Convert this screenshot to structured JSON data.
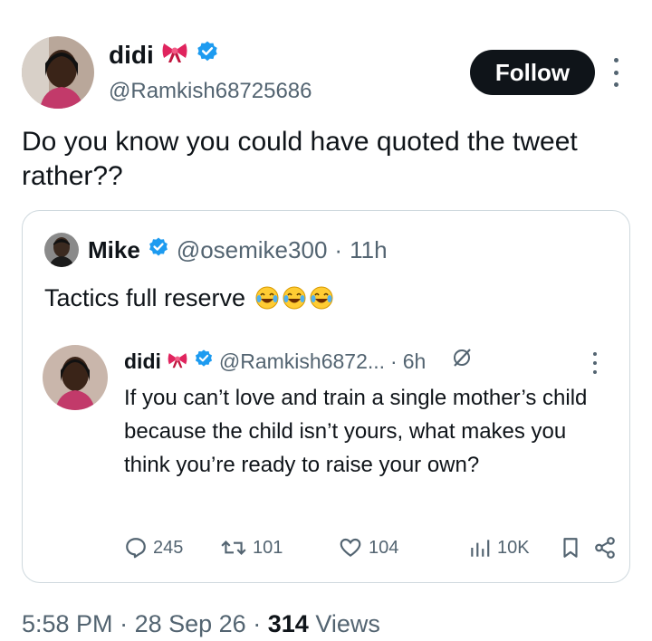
{
  "author": {
    "name": "didi",
    "handle": "@Ramkish68725686",
    "bow_icon": "bow-emoji",
    "verified_icon": "verified-badge-icon"
  },
  "follow_label": "Follow",
  "tweet": {
    "text": "Do you know you could have quoted the tweet rather??"
  },
  "quoted": {
    "name": "Mike",
    "handle": "@osemike300",
    "dot": "·",
    "time": "11h",
    "text": "Tactics full reserve",
    "emoji": "😂😂😂"
  },
  "inner": {
    "name": "didi",
    "handle": "@Ramkish6872...",
    "dot": "·",
    "time": "6h",
    "text": "If you can’t love and train a single mother’s child because the child isn’t yours, what makes you think you’re ready to raise your own?",
    "replies": "245",
    "reposts": "101",
    "likes": "104",
    "views": "10K"
  },
  "meta": {
    "time": "5:58 PM",
    "sep1": "·",
    "date": "28 Sep 26",
    "sep2": "·",
    "views_count": "314",
    "views_label": "Views"
  },
  "colors": {
    "text": "#0f1419",
    "secondary": "#536471",
    "verified": "#1d9bf0",
    "border": "#cfd9de"
  }
}
